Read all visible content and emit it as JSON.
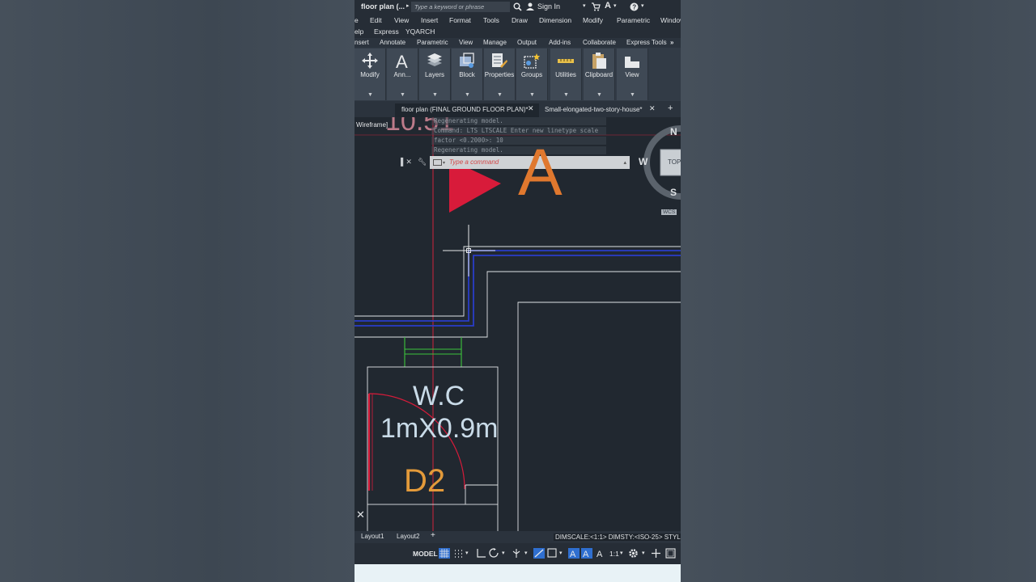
{
  "titlebar": {
    "file": "floor plan (...",
    "search_placeholder": "Type a keyword or phrase",
    "sign_in": "Sign In"
  },
  "menu": [
    "e",
    "Edit",
    "View",
    "Insert",
    "Format",
    "Tools",
    "Draw",
    "Dimension",
    "Modify",
    "Parametric",
    "Window",
    "elp",
    "Express",
    "YQARCH"
  ],
  "ribbon_tabs": [
    "nsert",
    "Annotate",
    "Parametric",
    "View",
    "Manage",
    "Output",
    "Add-ins",
    "Collaborate",
    "Express Tools"
  ],
  "ribbon_panels": [
    "Modify",
    "Ann...",
    "Layers",
    "Block",
    "Properties",
    "Groups",
    "Utilities",
    "Clipboard",
    "View"
  ],
  "file_tabs": {
    "active": "floor plan (FINAL GROUND FLOOR PLAN)*",
    "second": "Small-elongated-two-story-house*"
  },
  "canvas": {
    "viewport_label": "Wireframe]",
    "command_history": [
      "Regenerating model.",
      "Command: LTS LTSCALE Enter new linetype scale",
      "factor <0.2000>: 10",
      "Regenerating model."
    ],
    "command_placeholder": "Type a command",
    "viewcube": {
      "north": "N",
      "south": "S",
      "west": "W",
      "face": "TOP",
      "wcs": "WCS"
    },
    "big_label": "A",
    "top_partial_text": "10.51",
    "room_name": "W.C",
    "room_size": "1mX0.9m",
    "door_tag": "D2"
  },
  "layout_tabs": [
    "Layout1",
    "Layout2"
  ],
  "status": {
    "dims": "DIMSCALE:<1:1> DIMSTY:<ISO-25> STYLE:",
    "model": "MODEL",
    "scale": "1:1"
  },
  "colors": {
    "accent": "#2f6fd0",
    "orange": "#e07a32",
    "red": "#d81b3a"
  }
}
